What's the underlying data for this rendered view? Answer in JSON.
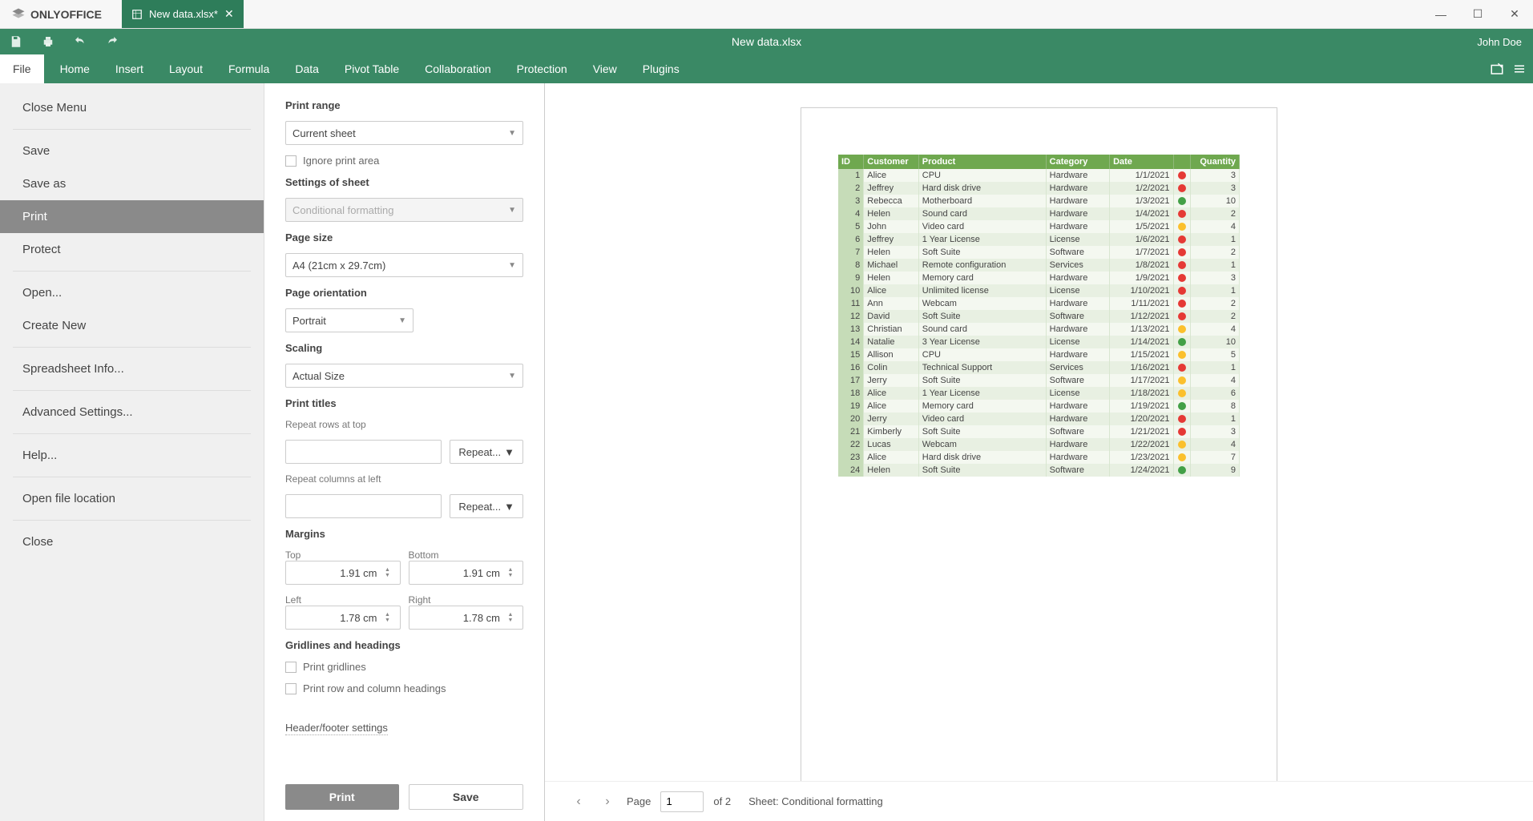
{
  "brand": "ONLYOFFICE",
  "tab_label": "New data.xlsx*",
  "doc_title": "New data.xlsx",
  "user": "John Doe",
  "menubar": [
    "File",
    "Home",
    "Insert",
    "Layout",
    "Formula",
    "Data",
    "Pivot Table",
    "Collaboration",
    "Protection",
    "View",
    "Plugins"
  ],
  "file_menu": {
    "close_menu": "Close Menu",
    "save": "Save",
    "save_as": "Save as",
    "print": "Print",
    "protect": "Protect",
    "open": "Open...",
    "create_new": "Create New",
    "spreadsheet_info": "Spreadsheet Info...",
    "advanced": "Advanced Settings...",
    "help": "Help...",
    "open_loc": "Open file location",
    "close": "Close"
  },
  "settings": {
    "print_range_label": "Print range",
    "print_range_value": "Current sheet",
    "ignore_print_area": "Ignore print area",
    "settings_of_sheet_label": "Settings of sheet",
    "settings_of_sheet_value": "Conditional formatting",
    "page_size_label": "Page size",
    "page_size_value": "A4 (21cm x 29.7cm)",
    "page_orientation_label": "Page orientation",
    "page_orientation_value": "Portrait",
    "scaling_label": "Scaling",
    "scaling_value": "Actual Size",
    "print_titles_label": "Print titles",
    "repeat_rows_label": "Repeat rows at top",
    "repeat_cols_label": "Repeat columns at left",
    "repeat_btn": "Repeat...",
    "margins_label": "Margins",
    "margin_top_label": "Top",
    "margin_bottom_label": "Bottom",
    "margin_left_label": "Left",
    "margin_right_label": "Right",
    "margin_top": "1.91 cm",
    "margin_bottom": "1.91 cm",
    "margin_left": "1.78 cm",
    "margin_right": "1.78 cm",
    "grid_head_label": "Gridlines and headings",
    "print_gridlines": "Print gridlines",
    "print_headings": "Print row and column headings",
    "header_footer": "Header/footer settings",
    "btn_print": "Print",
    "btn_save": "Save"
  },
  "footer": {
    "page_label": "Page",
    "page_current": "1",
    "page_total": "of 2",
    "sheet_label": "Sheet: Conditional formatting"
  },
  "table": {
    "headers": [
      "ID",
      "Customer",
      "Product",
      "Category",
      "Date",
      "",
      "Quantity"
    ],
    "rows": [
      {
        "id": 1,
        "customer": "Alice",
        "product": "CPU",
        "category": "Hardware",
        "date": "1/1/2021",
        "dot": "red",
        "qty": 3
      },
      {
        "id": 2,
        "customer": "Jeffrey",
        "product": "Hard disk drive",
        "category": "Hardware",
        "date": "1/2/2021",
        "dot": "red",
        "qty": 3
      },
      {
        "id": 3,
        "customer": "Rebecca",
        "product": "Motherboard",
        "category": "Hardware",
        "date": "1/3/2021",
        "dot": "green",
        "qty": 10
      },
      {
        "id": 4,
        "customer": "Helen",
        "product": "Sound card",
        "category": "Hardware",
        "date": "1/4/2021",
        "dot": "red",
        "qty": 2
      },
      {
        "id": 5,
        "customer": "John",
        "product": "Video card",
        "category": "Hardware",
        "date": "1/5/2021",
        "dot": "yellow",
        "qty": 4
      },
      {
        "id": 6,
        "customer": "Jeffrey",
        "product": "1 Year License",
        "category": "License",
        "date": "1/6/2021",
        "dot": "red",
        "qty": 1
      },
      {
        "id": 7,
        "customer": "Helen",
        "product": "Soft Suite",
        "category": "Software",
        "date": "1/7/2021",
        "dot": "red",
        "qty": 2
      },
      {
        "id": 8,
        "customer": "Michael",
        "product": "Remote configuration",
        "category": "Services",
        "date": "1/8/2021",
        "dot": "red",
        "qty": 1
      },
      {
        "id": 9,
        "customer": "Helen",
        "product": "Memory card",
        "category": "Hardware",
        "date": "1/9/2021",
        "dot": "red",
        "qty": 3
      },
      {
        "id": 10,
        "customer": "Alice",
        "product": "Unlimited license",
        "category": "License",
        "date": "1/10/2021",
        "dot": "red",
        "qty": 1
      },
      {
        "id": 11,
        "customer": "Ann",
        "product": "Webcam",
        "category": "Hardware",
        "date": "1/11/2021",
        "dot": "red",
        "qty": 2
      },
      {
        "id": 12,
        "customer": "David",
        "product": "Soft Suite",
        "category": "Software",
        "date": "1/12/2021",
        "dot": "red",
        "qty": 2
      },
      {
        "id": 13,
        "customer": "Christian",
        "product": "Sound card",
        "category": "Hardware",
        "date": "1/13/2021",
        "dot": "yellow",
        "qty": 4
      },
      {
        "id": 14,
        "customer": "Natalie",
        "product": "3 Year License",
        "category": "License",
        "date": "1/14/2021",
        "dot": "green",
        "qty": 10
      },
      {
        "id": 15,
        "customer": "Allison",
        "product": "CPU",
        "category": "Hardware",
        "date": "1/15/2021",
        "dot": "yellow",
        "qty": 5
      },
      {
        "id": 16,
        "customer": "Colin",
        "product": "Technical Support",
        "category": "Services",
        "date": "1/16/2021",
        "dot": "red",
        "qty": 1
      },
      {
        "id": 17,
        "customer": "Jerry",
        "product": "Soft Suite",
        "category": "Software",
        "date": "1/17/2021",
        "dot": "yellow",
        "qty": 4
      },
      {
        "id": 18,
        "customer": "Alice",
        "product": "1 Year License",
        "category": "License",
        "date": "1/18/2021",
        "dot": "yellow",
        "qty": 6
      },
      {
        "id": 19,
        "customer": "Alice",
        "product": "Memory card",
        "category": "Hardware",
        "date": "1/19/2021",
        "dot": "green",
        "qty": 8
      },
      {
        "id": 20,
        "customer": "Jerry",
        "product": "Video card",
        "category": "Hardware",
        "date": "1/20/2021",
        "dot": "red",
        "qty": 1
      },
      {
        "id": 21,
        "customer": "Kimberly",
        "product": "Soft Suite",
        "category": "Software",
        "date": "1/21/2021",
        "dot": "red",
        "qty": 3
      },
      {
        "id": 22,
        "customer": "Lucas",
        "product": "Webcam",
        "category": "Hardware",
        "date": "1/22/2021",
        "dot": "yellow",
        "qty": 4
      },
      {
        "id": 23,
        "customer": "Alice",
        "product": "Hard disk drive",
        "category": "Hardware",
        "date": "1/23/2021",
        "dot": "yellow",
        "qty": 7
      },
      {
        "id": 24,
        "customer": "Helen",
        "product": "Soft Suite",
        "category": "Software",
        "date": "1/24/2021",
        "dot": "green",
        "qty": 9
      }
    ]
  }
}
